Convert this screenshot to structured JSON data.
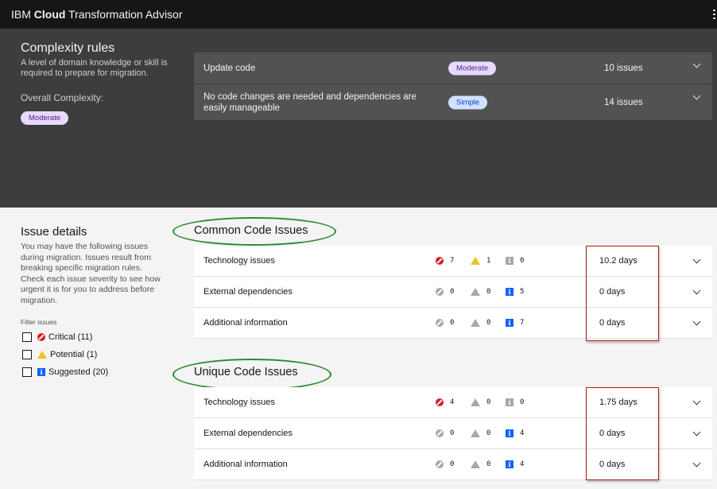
{
  "header": {
    "brand_prefix": "IBM",
    "brand_bold": "Cloud",
    "brand_suffix": "Transformation Advisor"
  },
  "complexity": {
    "title": "Complexity rules",
    "description": "A level of domain knowledge or skill is required to prepare for migration.",
    "overall_label": "Overall Complexity:",
    "overall_value": "Moderate",
    "rules": [
      {
        "text": "Update code",
        "tag": "Moderate",
        "tag_type": "moderate",
        "issues": "10 issues"
      },
      {
        "text": "No code changes are needed and dependencies are easily manageable",
        "tag": "Simple",
        "tag_type": "simple",
        "issues": "14 issues"
      }
    ]
  },
  "issue_details": {
    "title": "Issue details",
    "description": "You may have the following issues during migration. Issues result from breaking specific migration rules. Check each issue severity to see how urgent it is for you to address before migration.",
    "filter_label": "Filter issues",
    "filters": [
      {
        "label": "Critical (11)",
        "icon": "critical-icon"
      },
      {
        "label": "Potential (1)",
        "icon": "warning-icon"
      },
      {
        "label": "Suggested (20)",
        "icon": "info-icon"
      }
    ]
  },
  "common": {
    "title": "Common Code Issues",
    "rows": [
      {
        "name": "Technology issues",
        "critical": "7",
        "potential": "1",
        "suggested": "0",
        "days": "10.2 days"
      },
      {
        "name": "External dependencies",
        "critical": "0",
        "potential": "0",
        "suggested": "5",
        "days": "0 days"
      },
      {
        "name": "Additional information",
        "critical": "0",
        "potential": "0",
        "suggested": "7",
        "days": "0 days"
      }
    ]
  },
  "unique": {
    "title": "Unique Code Issues",
    "rows": [
      {
        "name": "Technology issues",
        "critical": "4",
        "potential": "0",
        "suggested": "0",
        "days": "1.75 days"
      },
      {
        "name": "External dependencies",
        "critical": "0",
        "potential": "0",
        "suggested": "4",
        "days": "0 days"
      },
      {
        "name": "Additional information",
        "critical": "0",
        "potential": "0",
        "suggested": "4",
        "days": "0 days"
      }
    ]
  },
  "colors": {
    "header_bg": "#161616",
    "panel_dark": "#3d3d3d",
    "row_dark": "#525252",
    "critical": "#da1e28",
    "warning": "#f1c21b",
    "info": "#0f62fe",
    "annotation_oval": "#2e8a2e",
    "annotation_box": "#a8201a"
  }
}
